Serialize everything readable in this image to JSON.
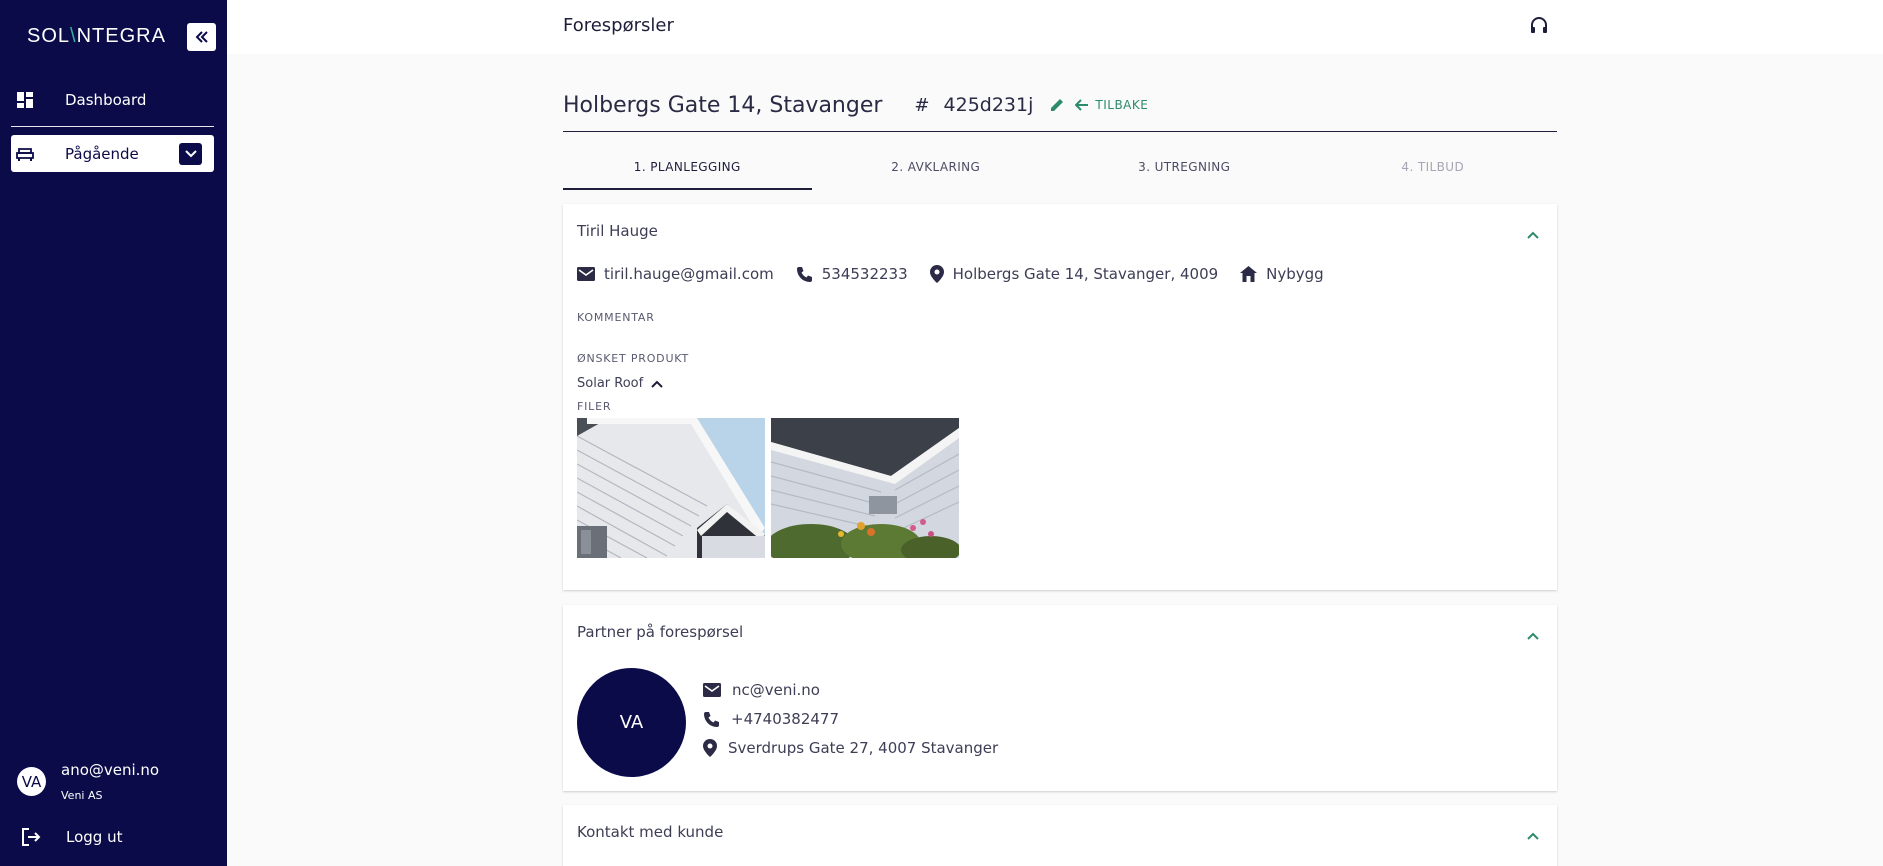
{
  "app": {
    "logo_prefix": "SOL",
    "logo_slash": "\\",
    "logo_suffix": "NTEGRA"
  },
  "sidebar": {
    "items": [
      {
        "label": "Dashboard",
        "icon": "dashboard-icon"
      },
      {
        "label": "Pågående",
        "icon": "sofa-icon"
      }
    ],
    "user": {
      "initials": "VA",
      "email": "ano@veni.no",
      "org": "Veni AS"
    },
    "logout_label": "Logg ut"
  },
  "topbar": {
    "title": "Forespørsler",
    "support_icon": "headset-icon"
  },
  "request": {
    "address": "Holbergs Gate 14, Stavanger",
    "hash": "#",
    "id": "425d231j",
    "back_label": "TILBAKE"
  },
  "steps": [
    {
      "label": "1. PLANLEGGING",
      "state": "active"
    },
    {
      "label": "2. AVKLARING",
      "state": "enabled"
    },
    {
      "label": "3. UTREGNING",
      "state": "enabled"
    },
    {
      "label": "4. TILBUD",
      "state": "disabled"
    }
  ],
  "customer": {
    "name": "Tiril Hauge",
    "email": "tiril.hauge@gmail.com",
    "phone": "534532233",
    "address": "Holbergs Gate 14, Stavanger, 4009",
    "building_type": "Nybygg",
    "comment_label": "KOMMENTAR",
    "product_label": "ØNSKET PRODUKT",
    "product": "Solar Roof",
    "files_label": "FILER"
  },
  "partner": {
    "title": "Partner på forespørsel",
    "initials": "VA",
    "email": "nc@veni.no",
    "phone": "+4740382477",
    "address": "Sverdrups Gate 27, 4007 Stavanger"
  },
  "contact": {
    "title": "Kontakt med kunde"
  },
  "colors": {
    "sidebar": "#0b0b4a",
    "accent": "#2e8b6a",
    "text": "#3d3d55"
  }
}
